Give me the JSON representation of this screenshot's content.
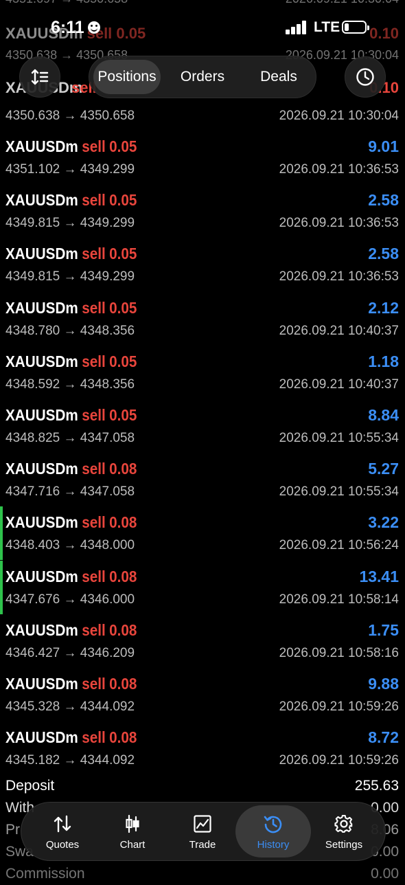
{
  "status_bar": {
    "time": "6:11",
    "network": "LTE"
  },
  "header": {
    "tabs": [
      "Positions",
      "Orders",
      "Deals"
    ],
    "active_tab": "Positions",
    "icons": [
      "sort-icon",
      "clock-icon"
    ]
  },
  "ghost_rows": [
    {
      "prices": "4351.697 → 4350.658",
      "time": "2026.09.21 10:30:04"
    },
    {
      "symbol": "XAUUSDm",
      "side": "sell",
      "volume": "0.05",
      "profit": "0.10",
      "prices": "4350.638 → 4350.658",
      "time": "2026.09.21 10:30:04"
    },
    {
      "symbol": "XAUUSDm",
      "side": "sell",
      "profit": "0.10"
    }
  ],
  "deals": [
    {
      "prices": "4350.638 → 4350.658",
      "time": "2026.09.21 10:30:04"
    },
    {
      "symbol": "XAUUSDm",
      "side": "sell",
      "volume": "0.05",
      "profit": "9.01",
      "prices": "4351.102 → 4349.299",
      "time": "2026.09.21 10:36:53"
    },
    {
      "symbol": "XAUUSDm",
      "side": "sell",
      "volume": "0.05",
      "profit": "2.58",
      "prices": "4349.815 → 4349.299",
      "time": "2026.09.21 10:36:53"
    },
    {
      "symbol": "XAUUSDm",
      "side": "sell",
      "volume": "0.05",
      "profit": "2.58",
      "prices": "4349.815 → 4349.299",
      "time": "2026.09.21 10:36:53"
    },
    {
      "symbol": "XAUUSDm",
      "side": "sell",
      "volume": "0.05",
      "profit": "2.12",
      "prices": "4348.780 → 4348.356",
      "time": "2026.09.21 10:40:37"
    },
    {
      "symbol": "XAUUSDm",
      "side": "sell",
      "volume": "0.05",
      "profit": "1.18",
      "prices": "4348.592 → 4348.356",
      "time": "2026.09.21 10:40:37"
    },
    {
      "symbol": "XAUUSDm",
      "side": "sell",
      "volume": "0.05",
      "profit": "8.84",
      "prices": "4348.825 → 4347.058",
      "time": "2026.09.21 10:55:34"
    },
    {
      "symbol": "XAUUSDm",
      "side": "sell",
      "volume": "0.08",
      "profit": "5.27",
      "prices": "4347.716 → 4347.058",
      "time": "2026.09.21 10:55:34"
    },
    {
      "symbol": "XAUUSDm",
      "side": "sell",
      "volume": "0.08",
      "profit": "3.22",
      "prices": "4348.403 → 4348.000",
      "time": "2026.09.21 10:56:24",
      "marked": true
    },
    {
      "symbol": "XAUUSDm",
      "side": "sell",
      "volume": "0.08",
      "profit": "13.41",
      "prices": "4347.676 → 4346.000",
      "time": "2026.09.21 10:58:14",
      "marked": true
    },
    {
      "symbol": "XAUUSDm",
      "side": "sell",
      "volume": "0.08",
      "profit": "1.75",
      "prices": "4346.427 → 4346.209",
      "time": "2026.09.21 10:58:16"
    },
    {
      "symbol": "XAUUSDm",
      "side": "sell",
      "volume": "0.08",
      "profit": "9.88",
      "prices": "4345.328 → 4344.092",
      "time": "2026.09.21 10:59:26"
    },
    {
      "symbol": "XAUUSDm",
      "side": "sell",
      "volume": "0.08",
      "profit": "8.72",
      "prices": "4345.182 → 4344.092",
      "time": "2026.09.21 10:59:26"
    }
  ],
  "summary": [
    {
      "label": "Deposit",
      "value": "255.63"
    },
    {
      "label": "With",
      "value": "0.00"
    },
    {
      "label": "Pr",
      "value": "8.06"
    },
    {
      "label": "Swa",
      "value": "0.00"
    },
    {
      "label": "Commission",
      "value": "0.00"
    }
  ],
  "tabbar": {
    "items": [
      {
        "label": "Quotes",
        "icon": "quotes-icon"
      },
      {
        "label": "Chart",
        "icon": "candlestick-icon"
      },
      {
        "label": "Trade",
        "icon": "trade-chart-icon"
      },
      {
        "label": "History",
        "icon": "history-icon"
      },
      {
        "label": "Settings",
        "icon": "gear-icon"
      }
    ],
    "active": "History"
  },
  "colors": {
    "background": "#000000",
    "sell": "#e8453c",
    "profit": "#3b8ef5",
    "marker": "#2ec24b",
    "secondary_text": "#bdbdbd"
  }
}
